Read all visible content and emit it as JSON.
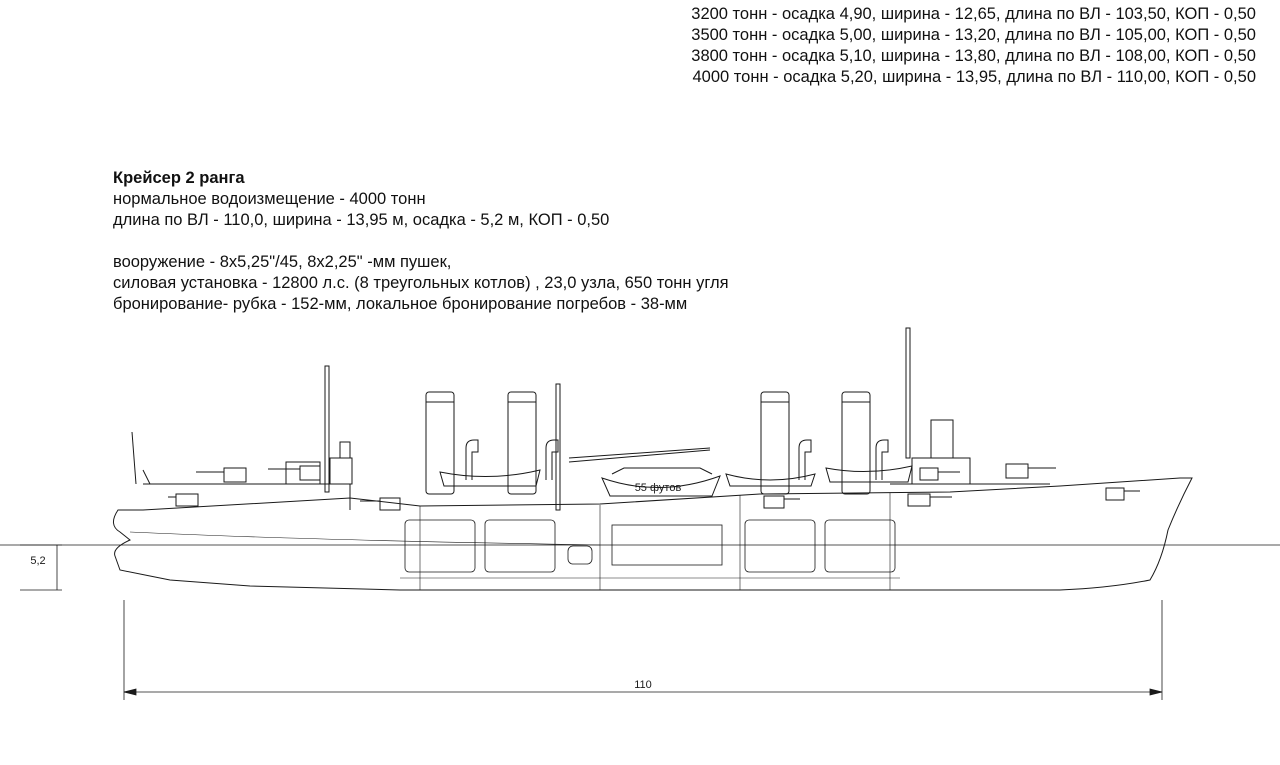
{
  "variants": [
    "3200 тонн - осадка 4,90, ширина - 12,65, длина по ВЛ - 103,50, КОП - 0,50",
    "3500 тонн - осадка 5,00, ширина - 13,20, длина по ВЛ - 105,00, КОП - 0,50",
    "3800 тонн - осадка 5,10, ширина - 13,80, длина по ВЛ - 108,00, КОП - 0,50",
    "4000 тонн - осадка 5,20, ширина - 13,95, длина по ВЛ - 110,00, КОП - 0,50"
  ],
  "spec": {
    "title": "Крейсер 2 ранга",
    "displacement": "нормальное водоизмещение - 4000 тонн",
    "dimensions": "длина по ВЛ - 110,0, ширина - 13,95 м, осадка - 5,2 м, КОП - 0,50",
    "armament": "вооружение - 8х5,25\"/45, 8х2,25\" -мм пушек,",
    "machinery": "силовая установка - 12800 л.с. (8 треугольных котлов) , 23,0 узла, 650 тонн угля",
    "armor": "бронирование- рубка - 152-мм, локальное бронирование погребов - 38-мм"
  },
  "drawing": {
    "boat_label": "55 футов",
    "draft_label": "5,2",
    "length_label": "110",
    "line_color": "#1a1a1a"
  }
}
